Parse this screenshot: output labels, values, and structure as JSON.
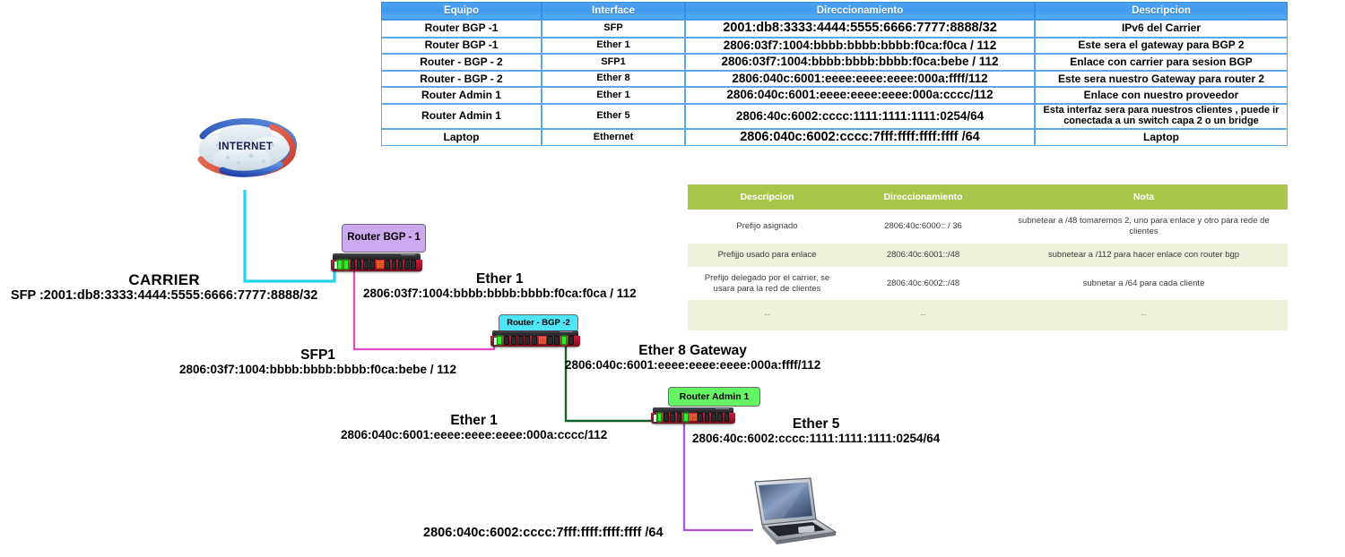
{
  "table_blue": {
    "headers": [
      "Equipo",
      "Interface",
      "Direccionamiento",
      "Descripcion"
    ],
    "rows": [
      {
        "equipo": "Router BGP -1",
        "interface": "SFP",
        "direccionamiento": "2001:db8:3333:4444:5555:6666:7777:8888/32",
        "descripcion": "IPv6 del Carrier"
      },
      {
        "equipo": "Router BGP -1",
        "interface": "Ether 1",
        "direccionamiento": "2806:03f7:1004:bbbb:bbbb:bbbb:f0ca:f0ca / 112",
        "descripcion": "Este sera el gateway para BGP 2"
      },
      {
        "equipo": "Router - BGP - 2",
        "interface": "SFP1",
        "direccionamiento": "2806:03f7:1004:bbbb:bbbb:bbbb:f0ca:bebe / 112",
        "descripcion": "Enlace con carrier para sesion BGP"
      },
      {
        "equipo": "Router - BGP - 2",
        "interface": "Ether 8",
        "direccionamiento": "2806:040c:6001:eeee:eeee:eeee:000a:ffff/112",
        "descripcion": "Este sera nuestro Gateway para router 2"
      },
      {
        "equipo": "Router Admin 1",
        "interface": "Ether 1",
        "direccionamiento": "2806:040c:6001:eeee:eeee:eeee:000a:cccc/112",
        "descripcion": "Enlace con nuestro proveedor"
      },
      {
        "equipo": "Router Admin 1",
        "interface": "Ether 5",
        "direccionamiento": "2806:40c:6002:cccc:1111:1111:1111:0254/64",
        "descripcion": "Esta interfaz sera para nuestros clientes , puede ir conectada a un switch capa 2 o un bridge"
      },
      {
        "equipo": "Laptop",
        "interface": "Ethernet",
        "direccionamiento": "2806:040c:6002:cccc:7fff:ffff:ffff:ffff /64",
        "descripcion": "Laptop"
      }
    ]
  },
  "table_green": {
    "headers": [
      "Descripcion",
      "Direccionamiento",
      "Nota"
    ],
    "rows": [
      {
        "descripcion": "Prefijo asignado",
        "direccionamiento": "2806:40c:6000:: / 36",
        "nota": "subnetear a /48  tomaremos 2, uno para enlace y otro para rede de clientes"
      },
      {
        "descripcion": "Prefijjo usado para enlace",
        "direccionamiento": "2806:40c:6001::/48",
        "nota": "subnetear a /112 para hacer enlace con router bgp"
      },
      {
        "descripcion": "Prefijo delegado por el carrier, se usara para la red de clientes",
        "direccionamiento": "2806:40c:6002::/48",
        "nota": "subnetar a /64 para cada cliente"
      },
      {
        "descripcion": "--",
        "direccionamiento": "--",
        "nota": "--"
      }
    ]
  },
  "diagram": {
    "internet_label": "INTERNET",
    "devices": {
      "bgp1": "Router BGP - 1",
      "bgp2": "Router - BGP -2",
      "admin": "Router Admin 1"
    },
    "labels": {
      "carrier_title": "CARRIER",
      "carrier_addr": "SFP :2001:db8:3333:4444:5555:6666:7777:8888/32",
      "bgp1_ether1_title": "Ether 1",
      "bgp1_ether1_addr": "2806:03f7:1004:bbbb:bbbb:bbbb:f0ca:f0ca / 112",
      "bgp2_sfp1_title": "SFP1",
      "bgp2_sfp1_addr": "2806:03f7:1004:bbbb:bbbb:bbbb:f0ca:bebe / 112",
      "bgp2_ether8_title": "Ether 8 Gateway",
      "bgp2_ether8_addr": "2806:040c:6001:eeee:eeee:eeee:000a:ffff/112",
      "admin_ether1_title": "Ether 1",
      "admin_ether1_addr": "2806:040c:6001:eeee:eeee:eeee:000a:cccc/112",
      "admin_ether5_title": "Ether 5",
      "admin_ether5_addr": "2806:40c:6002:cccc:1111:1111:1111:0254/64",
      "laptop_addr": "2806:040c:6002:cccc:7fff:ffff:ffff:ffff /64"
    },
    "link_colors": {
      "carrier": "#22d3ee",
      "bgp1_to_bgp2": "#e849c4",
      "bgp2_to_admin": "#14612b",
      "admin_to_laptop": "#a855e0"
    },
    "icons": {
      "internet": "internet-cloud-icon",
      "router": "router-device-icon",
      "laptop": "laptop-icon"
    }
  }
}
